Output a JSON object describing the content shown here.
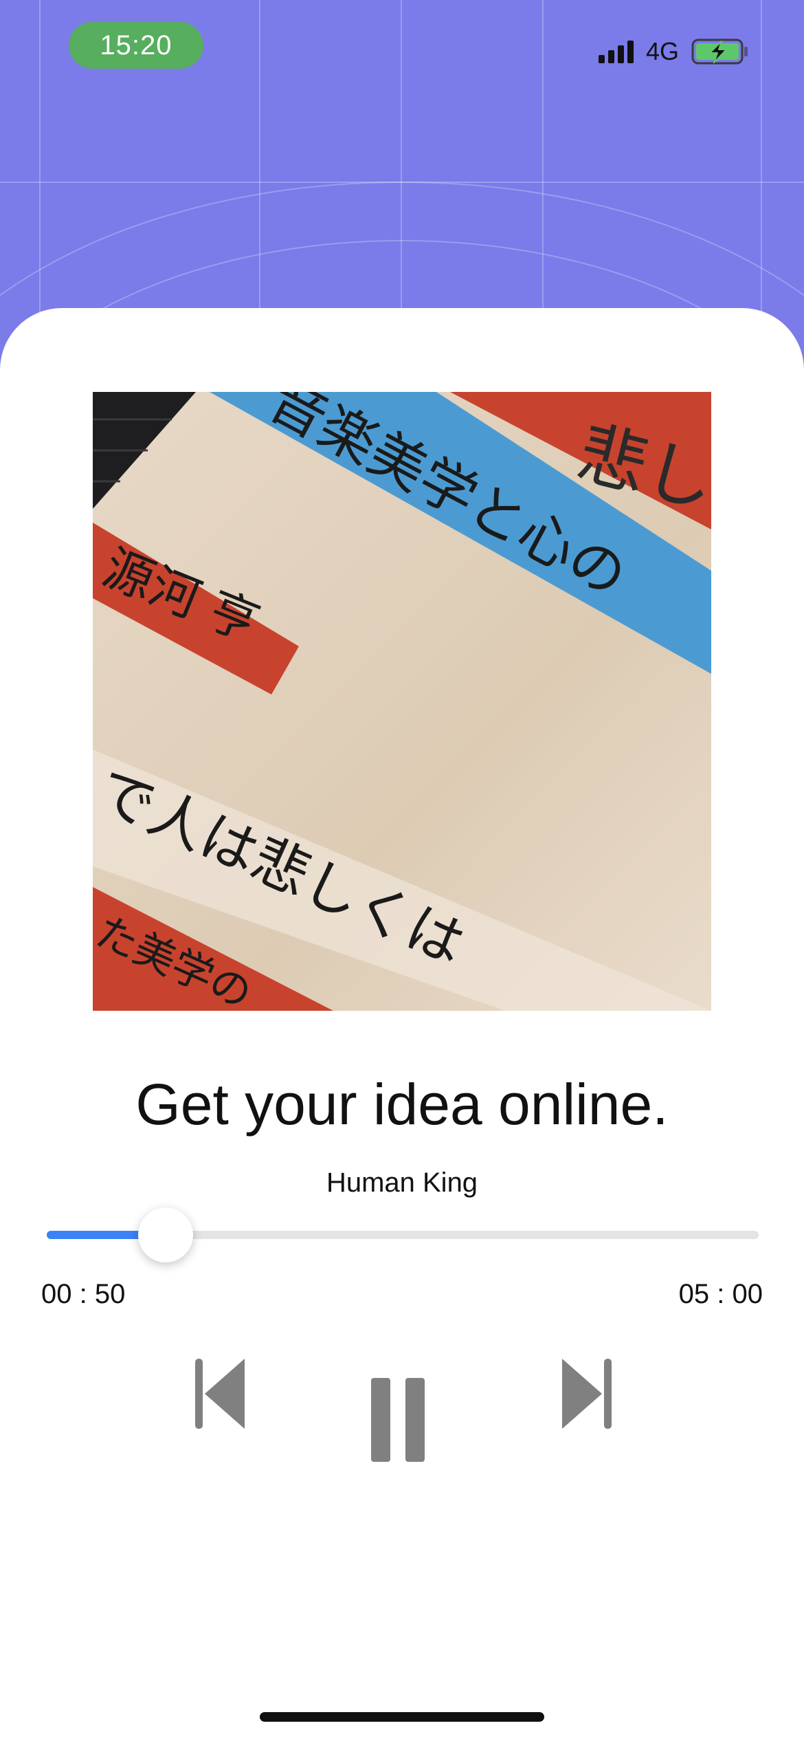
{
  "status_bar": {
    "time": "15:20",
    "network": "4G"
  },
  "player": {
    "title": "Get your idea online.",
    "artist": "Human King",
    "elapsed": "00 : 50",
    "duration": "05 : 00",
    "progress": 0.1667
  },
  "cover_art": {
    "banner_title": "音楽美学と心の",
    "banner_author": "源河 亨",
    "line_main": "で人は悲しくは",
    "line_lower": "た美学の",
    "corner_text": "悲しい"
  },
  "icons": {
    "previous": "skip-previous-icon",
    "pause": "pause-icon",
    "next": "skip-next-icon",
    "signal": "cellular-signal-icon",
    "battery": "battery-charging-icon"
  },
  "colors": {
    "background": "#7B7BEA",
    "accent": "#3B82F6",
    "time_pill": "#56AE5E",
    "controls": "#808080"
  }
}
